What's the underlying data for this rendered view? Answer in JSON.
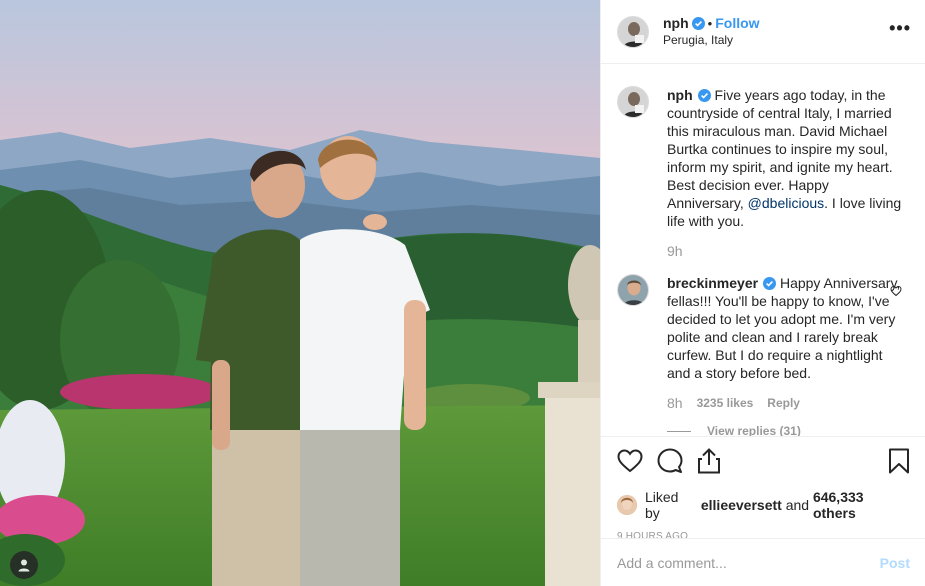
{
  "photo": {
    "alt_icon": "user-icon"
  },
  "header": {
    "username": "nph",
    "verified_icon": "verified-badge-icon",
    "separator": "•",
    "follow_label": "Follow",
    "location": "Perugia, Italy",
    "more_label": "•••"
  },
  "caption": {
    "username": "nph",
    "text_before": "Five years ago today, in the countryside of central Italy, I married this miraculous man. David Michael Burtka continues to inspire my soul, inform my spirit, and ignite my heart. Best decision ever. Happy Anniversary,",
    "mention": "@dbelicious",
    "text_after": ". I love living life with you.",
    "time": "9h"
  },
  "comment": {
    "username": "breckinmeyer",
    "text": "Happy Anniversary, fellas!!! You'll be happy to know, I've decided to let you adopt me. I'm very polite and clean and I rarely break curfew. But I do require a nightlight and a story before bed.",
    "time": "8h",
    "likes": "3235 likes",
    "reply_label": "Reply",
    "view_replies": "View replies (31)"
  },
  "actions": {
    "liked_prefix": "Liked by",
    "liked_user": "ellieeversett",
    "liked_and": "and",
    "liked_count": "646,333 others",
    "posted_ago": "9 HOURS AGO"
  },
  "add_comment": {
    "placeholder": "Add a comment...",
    "post_label": "Post"
  },
  "colors": {
    "link": "#3897f0",
    "mention": "#003569",
    "post_disabled": "#b3dbff",
    "muted": "#999999"
  }
}
